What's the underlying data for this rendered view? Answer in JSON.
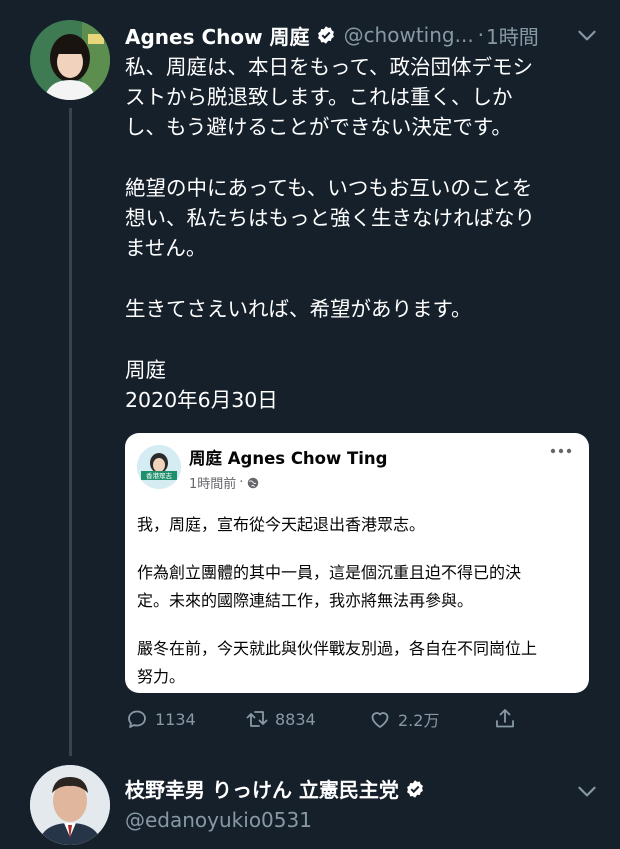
{
  "tweet": {
    "display_name": "Agnes Chow 周庭",
    "handle": "@chowting...",
    "separator": "·",
    "time": "1時間",
    "paragraphs": [
      "私、周庭は、本日をもって、政治団体デモシ\nストから脱退致します。これは重く、しか\nし、もう避けることができない決定です。",
      "絶望の中にあっても、いつもお互いのことを\n想い、私たちはもっと強く生きなければなり\nません。",
      "生きてさえいれば、希望があります。",
      "周庭\n2020年6月30日"
    ],
    "embedded_post": {
      "author": "周庭 Agnes Chow Ting",
      "time": "1時間前",
      "separator": "·",
      "avatar_text": "香港眾志",
      "paragraphs": [
        "我，周庭，宣布從今天起退出香港眾志。",
        "作為創立團體的其中一員，這是個沉重且迫不得已的決\n定。未來的國際連結工作，我亦將無法再參與。",
        "嚴冬在前，今天就此與伙伴戰友別過，各自在不同崗位上\n努力。"
      ]
    },
    "actions": {
      "replies": "1134",
      "retweets": "8834",
      "likes": "2.2万"
    }
  },
  "next_tweet": {
    "display_name": "枝野幸男 りっけん 立憲民主党",
    "handle": "@edanoyukio0531"
  },
  "colors": {
    "background": "#15202b",
    "secondary_text": "#8899a6",
    "thread_line": "#38444d",
    "card_background": "#ffffff"
  },
  "icons": [
    "verified-badge-icon",
    "chevron-down-icon",
    "globe-icon",
    "more-horizontal-icon",
    "reply-icon",
    "retweet-icon",
    "like-icon",
    "share-icon"
  ]
}
